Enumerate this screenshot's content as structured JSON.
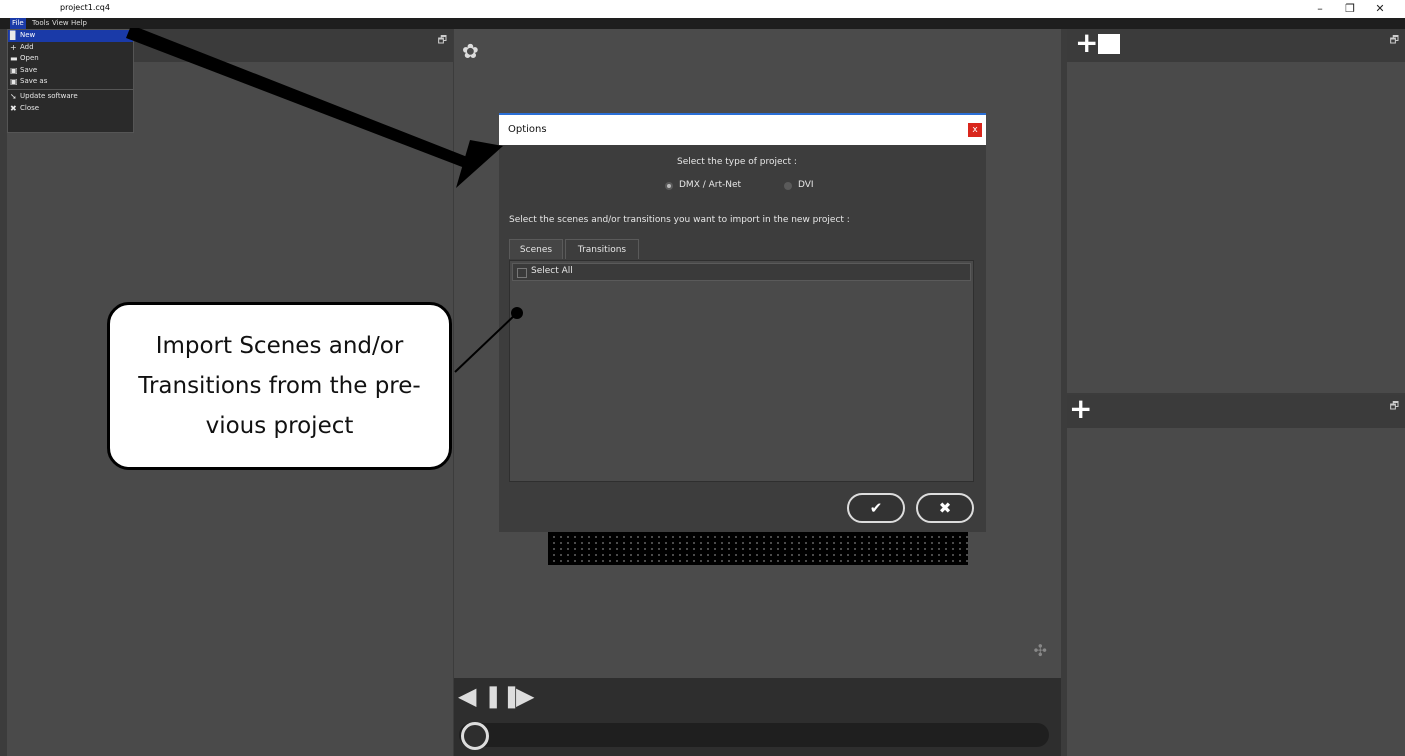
{
  "window": {
    "title": "project1.cq4",
    "minimize": "–",
    "restore": "❐",
    "close": "✕"
  },
  "menubar": {
    "items": [
      "File",
      "Tools",
      "View",
      "Help"
    ]
  },
  "file_menu": {
    "items": [
      {
        "label": "New",
        "icon": "document-icon"
      },
      {
        "label": "Add",
        "icon": "add-document-icon"
      },
      {
        "label": "Open",
        "icon": "folder-icon"
      },
      {
        "label": "Save",
        "icon": "floppy-icon"
      },
      {
        "label": "Save as",
        "icon": "floppy-icon"
      },
      {
        "label": "Update software",
        "icon": "arrow-icon"
      },
      {
        "label": "Close",
        "icon": "close-icon"
      }
    ]
  },
  "dialog": {
    "title": "Options",
    "close": "x",
    "project_type_label": "Select the type of project :",
    "radio_options": [
      {
        "label": "DMX / Art-Net",
        "selected": true
      },
      {
        "label": "DVI",
        "selected": false
      }
    ],
    "import_label": "Select the scenes and/or transitions you want to import in the new project :",
    "tabs": [
      "Scenes",
      "Transitions"
    ],
    "active_tab": "Scenes",
    "select_all": "Select All",
    "ok_label": "✔",
    "cancel_label": "✖"
  },
  "callout": {
    "text": "Import Scenes and/or Transitions from the pre-vious project"
  },
  "icons": {
    "gear": "✿",
    "plus": "+",
    "move": "✣",
    "restore": "🗗"
  },
  "player": {
    "prev": "◀",
    "pause": "❚❚",
    "next": "▶"
  },
  "colors": {
    "menu_highlight": "#1a3aa8",
    "dialog_close": "#d9261c",
    "dialog_accent": "#2a6fd6"
  }
}
